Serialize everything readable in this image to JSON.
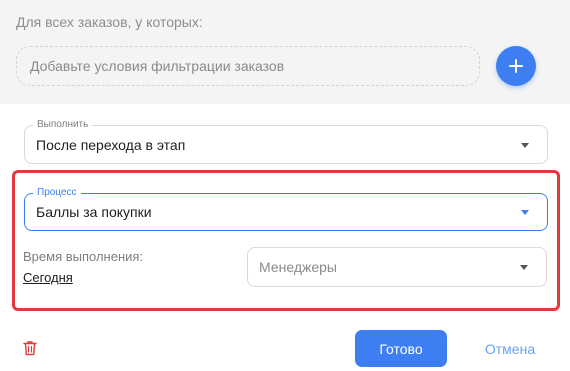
{
  "filter_section": {
    "title": "Для всех заказов, у которых:",
    "placeholder": "Добавьте условия фильтрации заказов",
    "add_icon": "plus-icon"
  },
  "execute_field": {
    "legend": "Выполнить",
    "value": "После перехода в этап"
  },
  "process_field": {
    "legend": "Процесс",
    "value": "Баллы за покупки"
  },
  "execution_time": {
    "label": "Время выполнения:",
    "value": "Сегодня"
  },
  "managers_field": {
    "placeholder": "Менеджеры"
  },
  "actions": {
    "delete_icon": "trash-icon",
    "done_label": "Готово",
    "cancel_label": "Отмена"
  },
  "colors": {
    "accent": "#3d7ff3",
    "highlight": "#e03a3a",
    "delete": "#e03a3a"
  }
}
